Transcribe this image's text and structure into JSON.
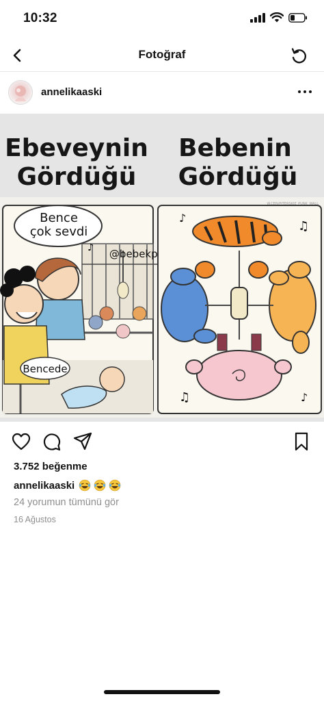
{
  "status_bar": {
    "time": "10:32"
  },
  "nav": {
    "title": "Fotoğraf"
  },
  "post": {
    "username": "annelikaaski",
    "image": {
      "left_title_line1": "Ebeveynin",
      "left_title_line2": "Gördüğü",
      "right_title_line1": "Bebenin",
      "right_title_line2": "Gördüğü",
      "bubble_line1": "Bence",
      "bubble_line2": "çok sevdi",
      "watermark": "@bebekpandacom",
      "baby_bubble": "Bencede",
      "credit": "W.CEN/PITERSKIE_PUNK_WALL"
    },
    "likes": "3.752 beğenme",
    "caption_user": "annelikaaski",
    "comments_link": "24 yorumun tümünü gör",
    "date": "16 Ağustos"
  },
  "icons": {
    "back": "chevron-left-icon",
    "refresh": "refresh-icon",
    "more": "more-horizontal-icon",
    "like": "heart-icon",
    "comment": "comment-icon",
    "share": "send-icon",
    "save": "bookmark-icon",
    "emoji": "laughing-tears-emoji"
  }
}
